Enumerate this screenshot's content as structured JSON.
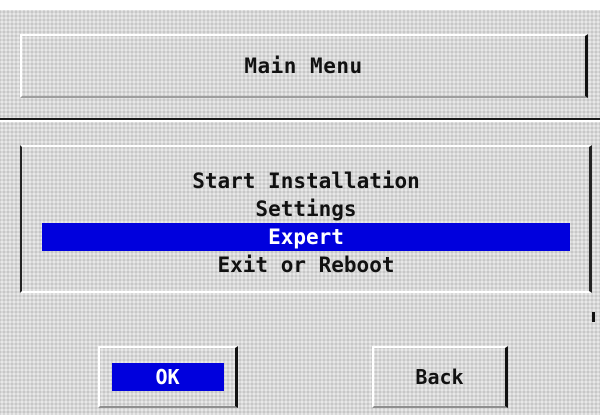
{
  "header": {
    "title": "Main Menu"
  },
  "menu": {
    "items": [
      {
        "label": "Start Installation",
        "selected": false
      },
      {
        "label": "Settings",
        "selected": false
      },
      {
        "label": "Expert",
        "selected": true
      },
      {
        "label": "Exit or Reboot",
        "selected": false
      }
    ]
  },
  "buttons": {
    "ok_label": "OK",
    "back_label": "Back"
  },
  "colors": {
    "background": "#d8d8d8",
    "selection": "#0000dd",
    "selection_text": "#ffffff",
    "text": "#111111"
  }
}
